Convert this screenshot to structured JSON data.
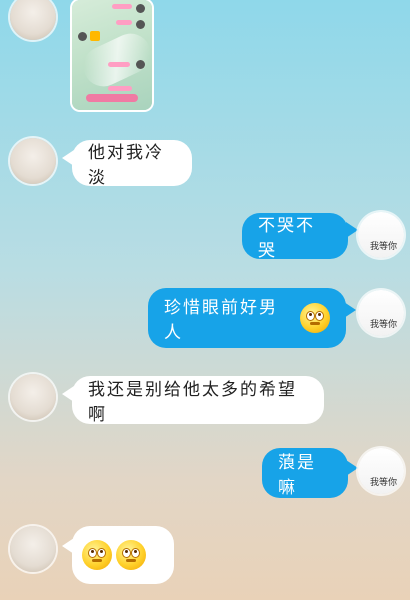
{
  "chat": {
    "messages": [
      {
        "side": "left",
        "text": "他对我冷淡"
      },
      {
        "side": "right",
        "text": "不哭不哭"
      },
      {
        "side": "right",
        "text": "珍惜眼前好男人"
      },
      {
        "side": "left",
        "text": "我还是别给他太多的希望啊"
      },
      {
        "side": "right",
        "text": "蒗是嘛"
      }
    ],
    "right_avatar_caption": "我等你"
  },
  "emoji": {
    "names": [
      "dazed-face-emoji",
      "rolling-eyes-emoji",
      "rolling-eyes-emoji"
    ]
  },
  "colors": {
    "right_bubble": "#17a3e8",
    "left_bubble": "#ffffff"
  }
}
